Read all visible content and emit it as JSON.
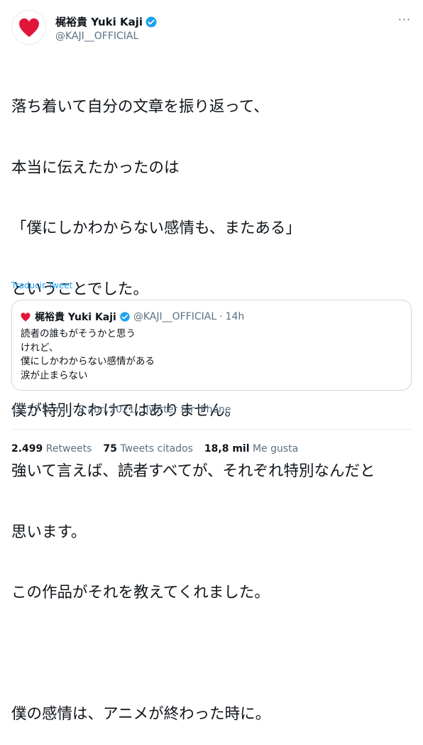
{
  "author": {
    "display_name": "梶裕貴 Yuki Kaji",
    "handle": "@KAJI__OFFICIAL",
    "avatar_icon": "red-heart-icon",
    "verified_icon": "verified-badge-icon",
    "accent_color": "#1da1f2",
    "heart_color": "#e0163a"
  },
  "more_menu_label": "···",
  "tweet": {
    "lines": [
      "落ち着いて自分の文章を振り返って、",
      "本当に伝えたかったのは",
      "「僕にしかわからない感情も、またある」",
      "ということでした。",
      "",
      "僕が特別なわけではありません。",
      "強いて言えば、読者すべてが、それぞれ特別なんだと",
      "思います。",
      "この作品がそれを教えてくれました。",
      "",
      "僕の感情は、アニメが終わった時に。"
    ],
    "translate_label": "Traducir Tweet"
  },
  "quoted_tweet": {
    "display_name": "梶裕貴 Yuki Kaji",
    "handle": "@KAJI__OFFICIAL",
    "separator": "·",
    "time": "14h",
    "lines": [
      "読者の誰もがそうかと思う",
      "けれど、",
      "僕にしかわからない感情がある",
      "涙が止まらない"
    ]
  },
  "meta": {
    "time": "12:17 p. m.",
    "separator": "·",
    "date": "8 abr. 2021",
    "source": "Twitter for iPhone"
  },
  "stats": {
    "retweets_count": "2.499",
    "retweets_label": "Retweets",
    "quotes_count": "75",
    "quotes_label": "Tweets citados",
    "likes_count": "18,8 mil",
    "likes_label": "Me gusta"
  }
}
